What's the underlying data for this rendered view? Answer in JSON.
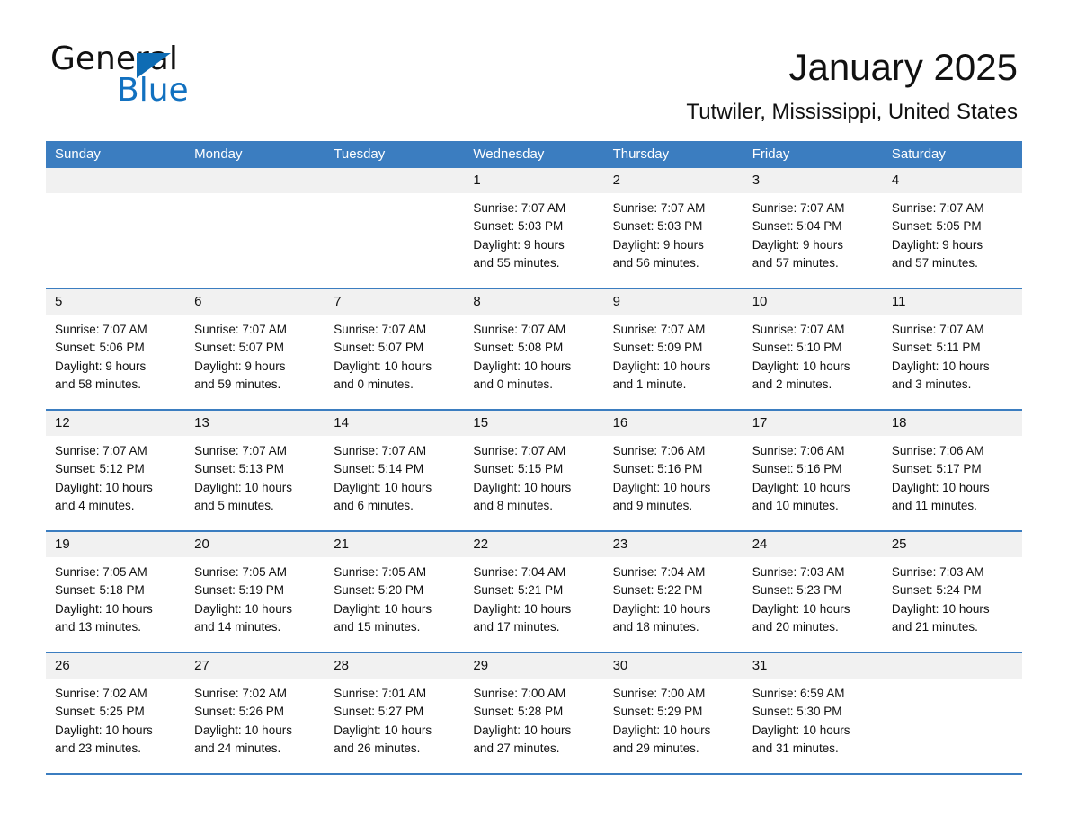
{
  "brand": {
    "name_part1": "General",
    "name_part2": "Blue",
    "accent_color": "#1271c0"
  },
  "header": {
    "title": "January 2025",
    "subtitle": "Tutwiler, Mississippi, United States"
  },
  "calendar": {
    "header_bg": "#3b7dc0",
    "daynum_bg": "#f1f1f1",
    "weekdays": [
      "Sunday",
      "Monday",
      "Tuesday",
      "Wednesday",
      "Thursday",
      "Friday",
      "Saturday"
    ],
    "weeks": [
      [
        {
          "day": "",
          "lines": []
        },
        {
          "day": "",
          "lines": []
        },
        {
          "day": "",
          "lines": []
        },
        {
          "day": "1",
          "lines": [
            "Sunrise: 7:07 AM",
            "Sunset: 5:03 PM",
            "Daylight: 9 hours",
            "and 55 minutes."
          ]
        },
        {
          "day": "2",
          "lines": [
            "Sunrise: 7:07 AM",
            "Sunset: 5:03 PM",
            "Daylight: 9 hours",
            "and 56 minutes."
          ]
        },
        {
          "day": "3",
          "lines": [
            "Sunrise: 7:07 AM",
            "Sunset: 5:04 PM",
            "Daylight: 9 hours",
            "and 57 minutes."
          ]
        },
        {
          "day": "4",
          "lines": [
            "Sunrise: 7:07 AM",
            "Sunset: 5:05 PM",
            "Daylight: 9 hours",
            "and 57 minutes."
          ]
        }
      ],
      [
        {
          "day": "5",
          "lines": [
            "Sunrise: 7:07 AM",
            "Sunset: 5:06 PM",
            "Daylight: 9 hours",
            "and 58 minutes."
          ]
        },
        {
          "day": "6",
          "lines": [
            "Sunrise: 7:07 AM",
            "Sunset: 5:07 PM",
            "Daylight: 9 hours",
            "and 59 minutes."
          ]
        },
        {
          "day": "7",
          "lines": [
            "Sunrise: 7:07 AM",
            "Sunset: 5:07 PM",
            "Daylight: 10 hours",
            "and 0 minutes."
          ]
        },
        {
          "day": "8",
          "lines": [
            "Sunrise: 7:07 AM",
            "Sunset: 5:08 PM",
            "Daylight: 10 hours",
            "and 0 minutes."
          ]
        },
        {
          "day": "9",
          "lines": [
            "Sunrise: 7:07 AM",
            "Sunset: 5:09 PM",
            "Daylight: 10 hours",
            "and 1 minute."
          ]
        },
        {
          "day": "10",
          "lines": [
            "Sunrise: 7:07 AM",
            "Sunset: 5:10 PM",
            "Daylight: 10 hours",
            "and 2 minutes."
          ]
        },
        {
          "day": "11",
          "lines": [
            "Sunrise: 7:07 AM",
            "Sunset: 5:11 PM",
            "Daylight: 10 hours",
            "and 3 minutes."
          ]
        }
      ],
      [
        {
          "day": "12",
          "lines": [
            "Sunrise: 7:07 AM",
            "Sunset: 5:12 PM",
            "Daylight: 10 hours",
            "and 4 minutes."
          ]
        },
        {
          "day": "13",
          "lines": [
            "Sunrise: 7:07 AM",
            "Sunset: 5:13 PM",
            "Daylight: 10 hours",
            "and 5 minutes."
          ]
        },
        {
          "day": "14",
          "lines": [
            "Sunrise: 7:07 AM",
            "Sunset: 5:14 PM",
            "Daylight: 10 hours",
            "and 6 minutes."
          ]
        },
        {
          "day": "15",
          "lines": [
            "Sunrise: 7:07 AM",
            "Sunset: 5:15 PM",
            "Daylight: 10 hours",
            "and 8 minutes."
          ]
        },
        {
          "day": "16",
          "lines": [
            "Sunrise: 7:06 AM",
            "Sunset: 5:16 PM",
            "Daylight: 10 hours",
            "and 9 minutes."
          ]
        },
        {
          "day": "17",
          "lines": [
            "Sunrise: 7:06 AM",
            "Sunset: 5:16 PM",
            "Daylight: 10 hours",
            "and 10 minutes."
          ]
        },
        {
          "day": "18",
          "lines": [
            "Sunrise: 7:06 AM",
            "Sunset: 5:17 PM",
            "Daylight: 10 hours",
            "and 11 minutes."
          ]
        }
      ],
      [
        {
          "day": "19",
          "lines": [
            "Sunrise: 7:05 AM",
            "Sunset: 5:18 PM",
            "Daylight: 10 hours",
            "and 13 minutes."
          ]
        },
        {
          "day": "20",
          "lines": [
            "Sunrise: 7:05 AM",
            "Sunset: 5:19 PM",
            "Daylight: 10 hours",
            "and 14 minutes."
          ]
        },
        {
          "day": "21",
          "lines": [
            "Sunrise: 7:05 AM",
            "Sunset: 5:20 PM",
            "Daylight: 10 hours",
            "and 15 minutes."
          ]
        },
        {
          "day": "22",
          "lines": [
            "Sunrise: 7:04 AM",
            "Sunset: 5:21 PM",
            "Daylight: 10 hours",
            "and 17 minutes."
          ]
        },
        {
          "day": "23",
          "lines": [
            "Sunrise: 7:04 AM",
            "Sunset: 5:22 PM",
            "Daylight: 10 hours",
            "and 18 minutes."
          ]
        },
        {
          "day": "24",
          "lines": [
            "Sunrise: 7:03 AM",
            "Sunset: 5:23 PM",
            "Daylight: 10 hours",
            "and 20 minutes."
          ]
        },
        {
          "day": "25",
          "lines": [
            "Sunrise: 7:03 AM",
            "Sunset: 5:24 PM",
            "Daylight: 10 hours",
            "and 21 minutes."
          ]
        }
      ],
      [
        {
          "day": "26",
          "lines": [
            "Sunrise: 7:02 AM",
            "Sunset: 5:25 PM",
            "Daylight: 10 hours",
            "and 23 minutes."
          ]
        },
        {
          "day": "27",
          "lines": [
            "Sunrise: 7:02 AM",
            "Sunset: 5:26 PM",
            "Daylight: 10 hours",
            "and 24 minutes."
          ]
        },
        {
          "day": "28",
          "lines": [
            "Sunrise: 7:01 AM",
            "Sunset: 5:27 PM",
            "Daylight: 10 hours",
            "and 26 minutes."
          ]
        },
        {
          "day": "29",
          "lines": [
            "Sunrise: 7:00 AM",
            "Sunset: 5:28 PM",
            "Daylight: 10 hours",
            "and 27 minutes."
          ]
        },
        {
          "day": "30",
          "lines": [
            "Sunrise: 7:00 AM",
            "Sunset: 5:29 PM",
            "Daylight: 10 hours",
            "and 29 minutes."
          ]
        },
        {
          "day": "31",
          "lines": [
            "Sunrise: 6:59 AM",
            "Sunset: 5:30 PM",
            "Daylight: 10 hours",
            "and 31 minutes."
          ]
        },
        {
          "day": "",
          "lines": []
        }
      ]
    ]
  }
}
